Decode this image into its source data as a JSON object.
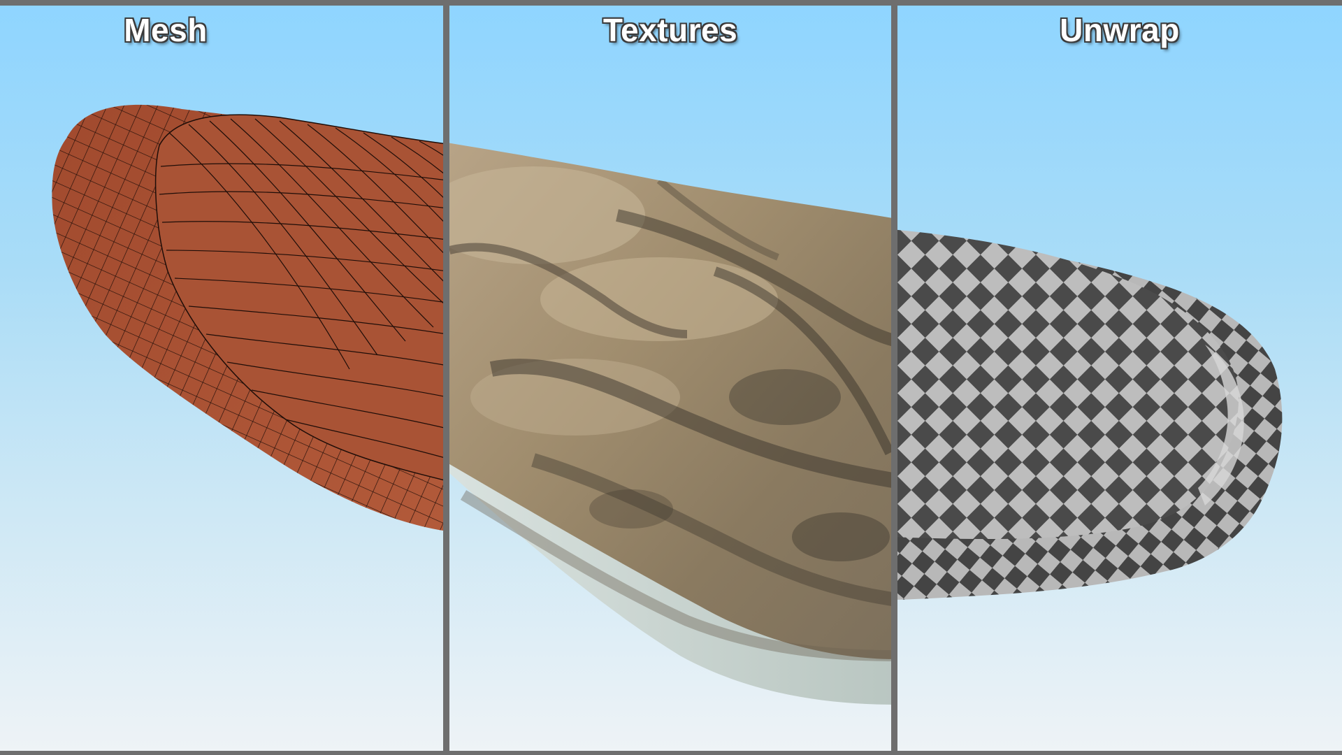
{
  "panels": {
    "mesh": {
      "title": "Mesh"
    },
    "textures": {
      "title": "Textures"
    },
    "unwrap": {
      "title": "Unwrap"
    }
  },
  "colors": {
    "sky_top": "#8fd5ff",
    "sky_bottom": "#eef3f6",
    "divider": "#6e6e6e",
    "mesh_fill": "#a64f33",
    "mesh_wire": "#1e0d08",
    "checker_dark": "#4a4a4a",
    "checker_light": "#bdbdbd"
  }
}
